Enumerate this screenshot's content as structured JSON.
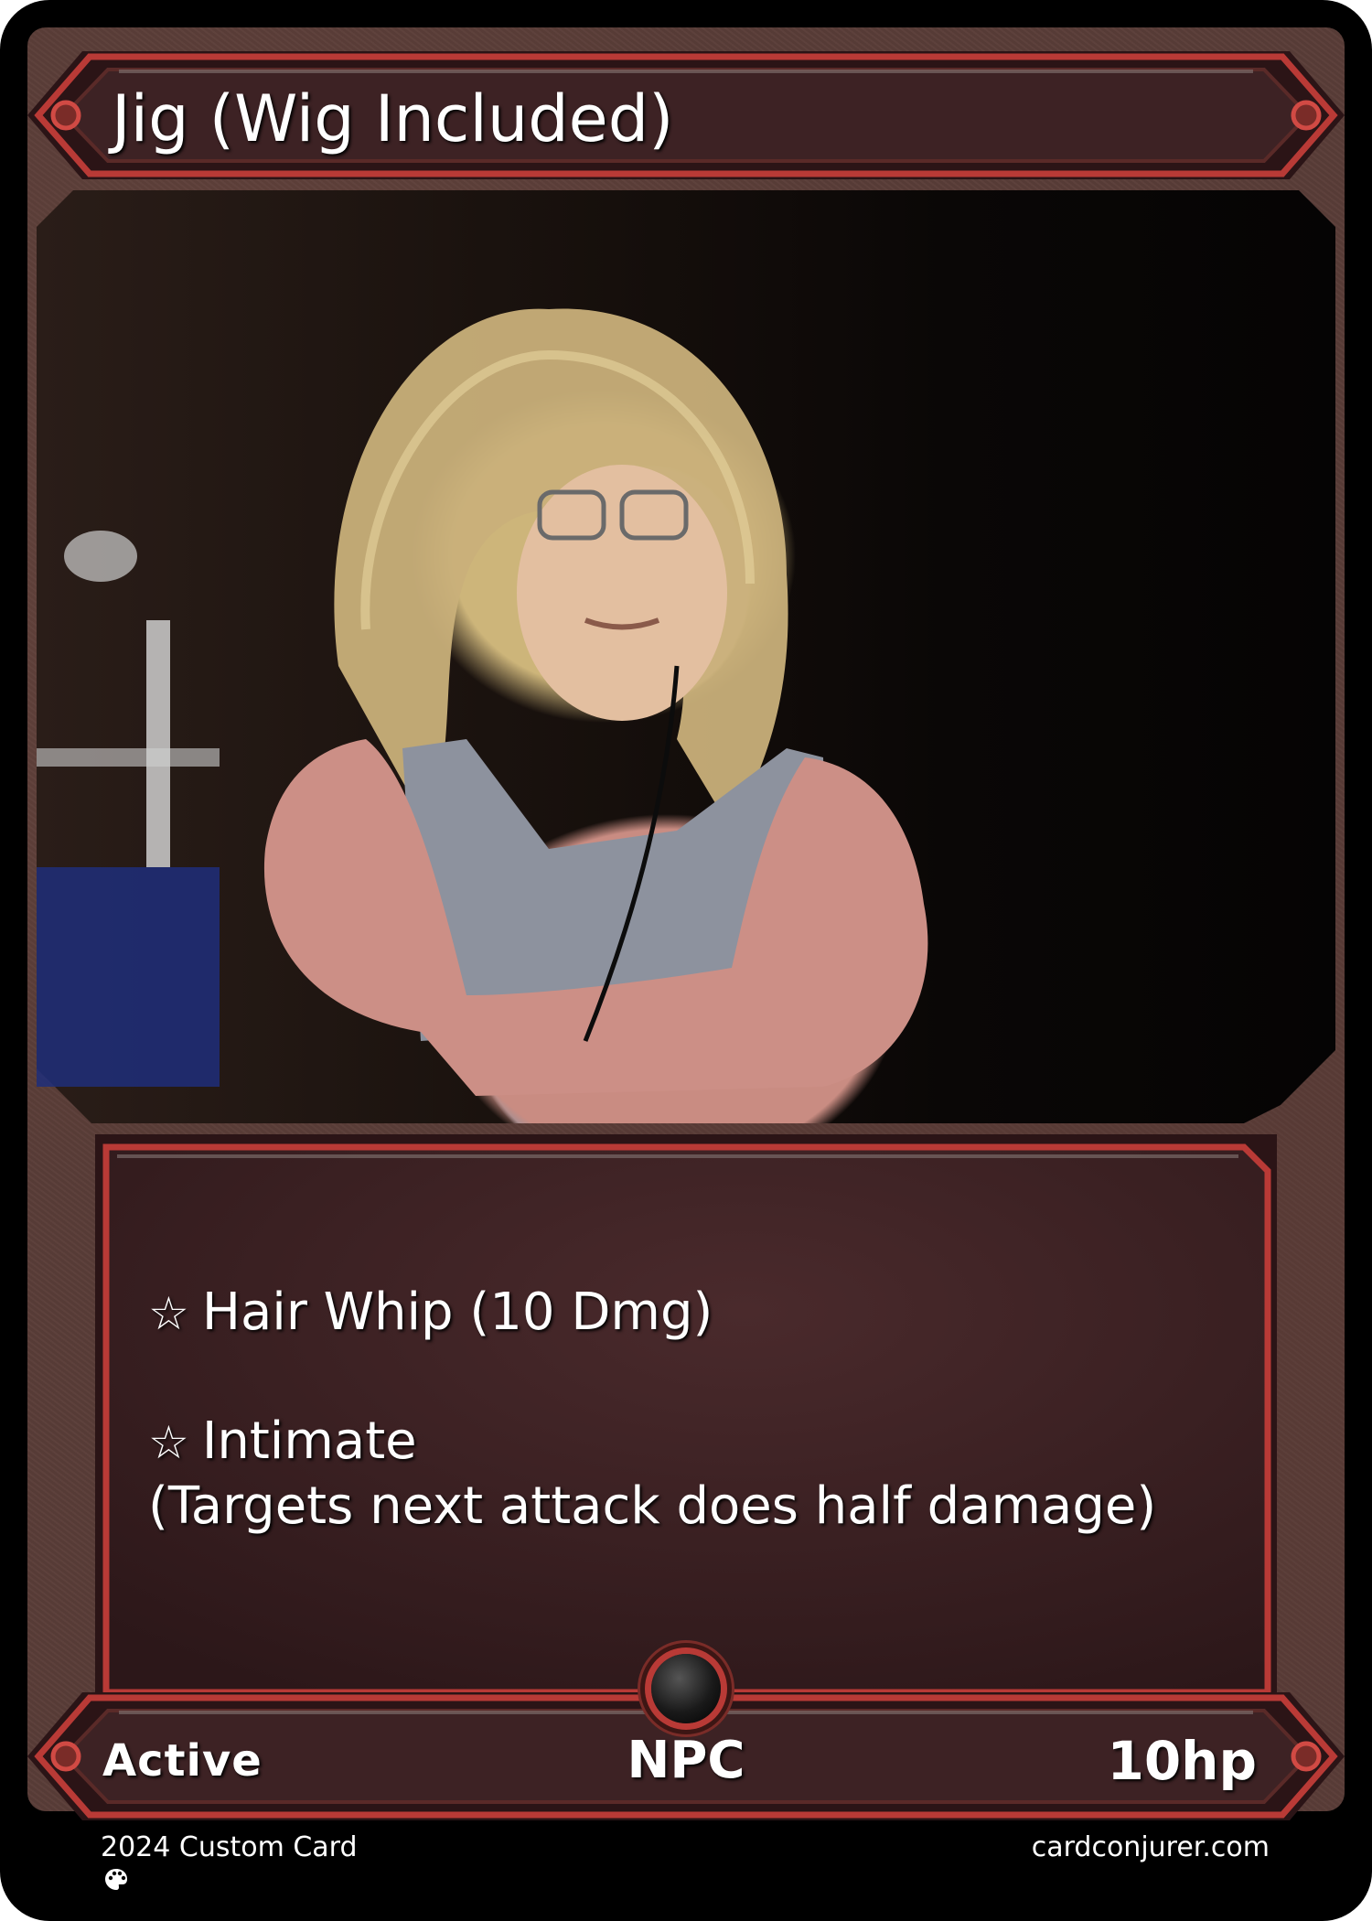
{
  "card": {
    "name": "Jig (Wig Included)",
    "abilities": [
      {
        "bullet": "☆",
        "text": "Hair Whip (10 Dmg)"
      },
      {
        "bullet": "☆",
        "text": "Intimate",
        "note": "(Targets next attack does half damage)"
      }
    ],
    "status": "Active",
    "type": "NPC",
    "hp": "10hp"
  },
  "footer": {
    "copyright": "2024 Custom Card",
    "site": "cardconjurer.com",
    "artist_icon": "palette-icon"
  },
  "colors": {
    "frame_red": "#b93a36",
    "panel_dark": "#3d2224",
    "card_black": "#000000",
    "texture_brown": "#5a3d38"
  }
}
